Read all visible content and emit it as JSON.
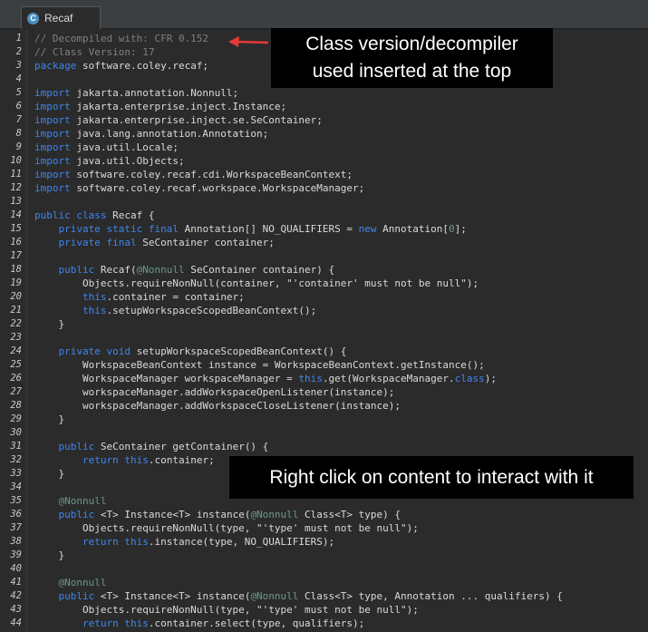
{
  "tab": {
    "label": "Recaf",
    "icon": "class-file-icon",
    "icon_letter": "C"
  },
  "callouts": {
    "top_line1": "Class version/decompiler",
    "top_line2": "used inserted at the top",
    "bottom": "Right click on content to interact with it"
  },
  "code_lines": [
    {
      "n": "1",
      "t": [
        [
          "cm",
          "// Decompiled with: CFR 0.152"
        ]
      ]
    },
    {
      "n": "2",
      "t": [
        [
          "cm",
          "// Class Version: 17"
        ]
      ]
    },
    {
      "n": "3",
      "t": [
        [
          "kw",
          "package"
        ],
        [
          "",
          "software.coley.recaf;"
        ]
      ]
    },
    {
      "n": "4",
      "t": []
    },
    {
      "n": "5",
      "t": [
        [
          "kw",
          "import"
        ],
        [
          "",
          "jakarta.annotation.Nonnull;"
        ]
      ]
    },
    {
      "n": "6",
      "t": [
        [
          "kw",
          "import"
        ],
        [
          "",
          "jakarta.enterprise.inject.Instance;"
        ]
      ]
    },
    {
      "n": "7",
      "t": [
        [
          "kw",
          "import"
        ],
        [
          "",
          "jakarta.enterprise.inject.se.SeContainer;"
        ]
      ]
    },
    {
      "n": "8",
      "t": [
        [
          "kw",
          "import"
        ],
        [
          "",
          "java.lang.annotation.Annotation;"
        ]
      ]
    },
    {
      "n": "9",
      "t": [
        [
          "kw",
          "import"
        ],
        [
          "",
          "java.util.Locale;"
        ]
      ]
    },
    {
      "n": "10",
      "t": [
        [
          "kw",
          "import"
        ],
        [
          "",
          "java.util.Objects;"
        ]
      ]
    },
    {
      "n": "11",
      "t": [
        [
          "kw",
          "import"
        ],
        [
          "",
          "software.coley.recaf.cdi.WorkspaceBeanContext;"
        ]
      ]
    },
    {
      "n": "12",
      "t": [
        [
          "kw",
          "import"
        ],
        [
          "",
          "software.coley.recaf.workspace.WorkspaceManager;"
        ]
      ]
    },
    {
      "n": "13",
      "t": []
    },
    {
      "n": "14",
      "t": [
        [
          "kw",
          "public class"
        ],
        [
          "",
          " Recaf {"
        ]
      ]
    },
    {
      "n": "15",
      "t": [
        [
          "",
          "    "
        ],
        [
          "kw",
          "private static final"
        ],
        [
          "",
          " Annotation[] NO_QUALIFIERS = "
        ],
        [
          "kw",
          "new"
        ],
        [
          "",
          " Annotation["
        ],
        [
          "an",
          "0"
        ],
        [
          "",
          "];"
        ]
      ]
    },
    {
      "n": "16",
      "t": [
        [
          "",
          "    "
        ],
        [
          "kw",
          "private final"
        ],
        [
          "",
          " SeContainer container;"
        ]
      ]
    },
    {
      "n": "17",
      "t": []
    },
    {
      "n": "18",
      "t": [
        [
          "",
          "    "
        ],
        [
          "kw",
          "public"
        ],
        [
          "",
          " Recaf("
        ],
        [
          "an",
          "@Nonnull"
        ],
        [
          "",
          " SeContainer container) {"
        ]
      ]
    },
    {
      "n": "19",
      "t": [
        [
          "",
          "        Objects.requireNonNull(container, "
        ],
        [
          "st",
          "\"'container' must not be null\""
        ],
        [
          "",
          ");"
        ]
      ]
    },
    {
      "n": "20",
      "t": [
        [
          "",
          "        "
        ],
        [
          "kw",
          "this"
        ],
        [
          "",
          ".container = container;"
        ]
      ]
    },
    {
      "n": "21",
      "t": [
        [
          "",
          "        "
        ],
        [
          "kw",
          "this"
        ],
        [
          "",
          ".setupWorkspaceScopedBeanContext();"
        ]
      ]
    },
    {
      "n": "22",
      "t": [
        [
          "",
          "    }"
        ]
      ]
    },
    {
      "n": "23",
      "t": []
    },
    {
      "n": "24",
      "t": [
        [
          "",
          "    "
        ],
        [
          "kw",
          "private void"
        ],
        [
          "",
          " setupWorkspaceScopedBeanContext() {"
        ]
      ]
    },
    {
      "n": "25",
      "t": [
        [
          "",
          "        WorkspaceBeanContext instance = WorkspaceBeanContext.getInstance();"
        ]
      ]
    },
    {
      "n": "26",
      "t": [
        [
          "",
          "        WorkspaceManager workspaceManager = "
        ],
        [
          "kw",
          "this"
        ],
        [
          "",
          ".get(WorkspaceManager."
        ],
        [
          "kw",
          "class"
        ],
        [
          "",
          ");"
        ]
      ]
    },
    {
      "n": "27",
      "t": [
        [
          "",
          "        workspaceManager.addWorkspaceOpenListener(instance);"
        ]
      ]
    },
    {
      "n": "28",
      "t": [
        [
          "",
          "        workspaceManager.addWorkspaceCloseListener(instance);"
        ]
      ]
    },
    {
      "n": "29",
      "t": [
        [
          "",
          "    }"
        ]
      ]
    },
    {
      "n": "30",
      "t": []
    },
    {
      "n": "31",
      "t": [
        [
          "",
          "    "
        ],
        [
          "kw",
          "public"
        ],
        [
          "",
          " SeContainer getContainer() {"
        ]
      ]
    },
    {
      "n": "32",
      "t": [
        [
          "",
          "        "
        ],
        [
          "kw",
          "return this"
        ],
        [
          "",
          ".container;"
        ]
      ]
    },
    {
      "n": "33",
      "t": [
        [
          "",
          "    }"
        ]
      ]
    },
    {
      "n": "34",
      "t": []
    },
    {
      "n": "35",
      "t": [
        [
          "",
          "    "
        ],
        [
          "an",
          "@Nonnull"
        ]
      ]
    },
    {
      "n": "36",
      "t": [
        [
          "",
          "    "
        ],
        [
          "kw",
          "public"
        ],
        [
          "",
          " <T> Instance<T> instance("
        ],
        [
          "an",
          "@Nonnull"
        ],
        [
          "",
          " Class<T> type) {"
        ]
      ]
    },
    {
      "n": "37",
      "t": [
        [
          "",
          "        Objects.requireNonNull(type, "
        ],
        [
          "st",
          "\"'type' must not be null\""
        ],
        [
          "",
          ");"
        ]
      ]
    },
    {
      "n": "38",
      "t": [
        [
          "",
          "        "
        ],
        [
          "kw",
          "return this"
        ],
        [
          "",
          ".instance(type, NO_QUALIFIERS);"
        ]
      ]
    },
    {
      "n": "39",
      "t": [
        [
          "",
          "    }"
        ]
      ]
    },
    {
      "n": "40",
      "t": []
    },
    {
      "n": "41",
      "t": [
        [
          "",
          "    "
        ],
        [
          "an",
          "@Nonnull"
        ]
      ]
    },
    {
      "n": "42",
      "t": [
        [
          "",
          "    "
        ],
        [
          "kw",
          "public"
        ],
        [
          "",
          " <T> Instance<T> instance("
        ],
        [
          "an",
          "@Nonnull"
        ],
        [
          "",
          " Class<T> type, Annotation ... qualifiers) {"
        ]
      ]
    },
    {
      "n": "43",
      "t": [
        [
          "",
          "        Objects.requireNonNull(type, "
        ],
        [
          "st",
          "\"'type' must not be null\""
        ],
        [
          "",
          ");"
        ]
      ]
    },
    {
      "n": "44",
      "t": [
        [
          "",
          "        "
        ],
        [
          "kw",
          "return this"
        ],
        [
          "",
          ".container.select(type, qualifiers);"
        ]
      ]
    }
  ]
}
